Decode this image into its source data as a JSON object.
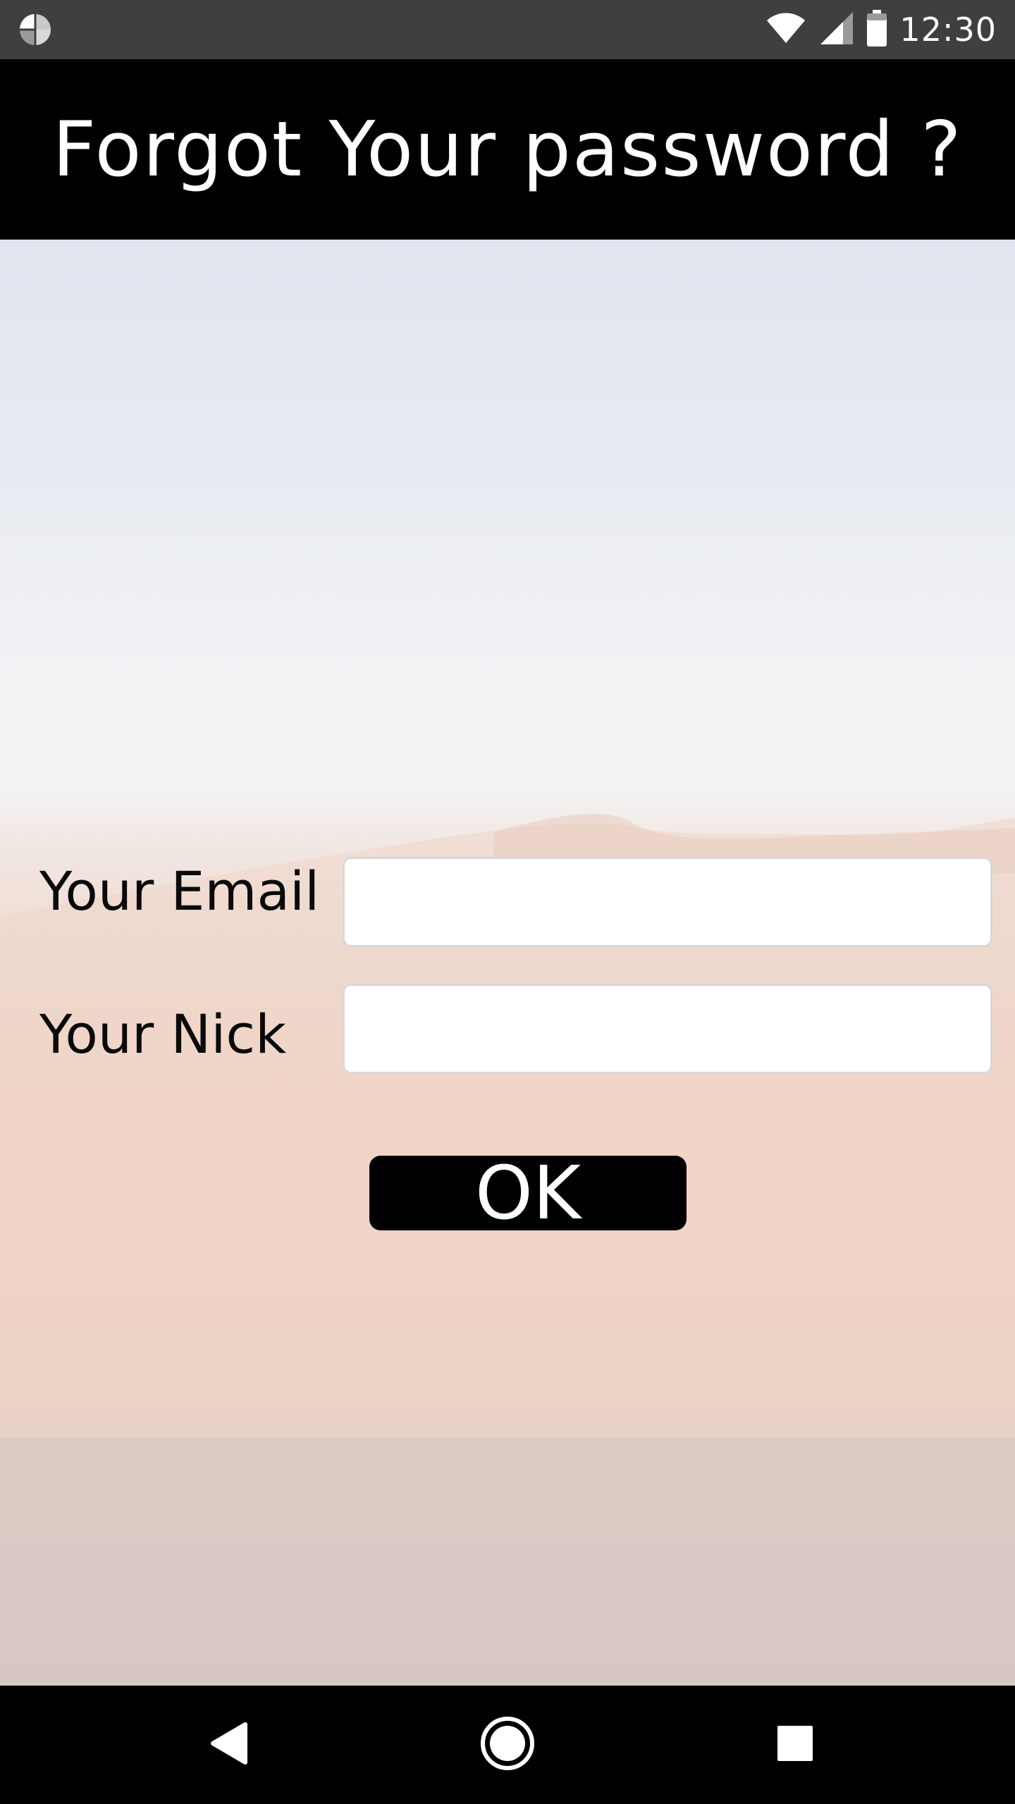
{
  "status_bar": {
    "time": "12:30",
    "app_icon": "pie-chart-icon",
    "icons": [
      "wifi-icon",
      "signal-icon",
      "battery-icon"
    ]
  },
  "header": {
    "title": "Forgot Your password ?"
  },
  "form": {
    "email_label": "Your Email",
    "email_value": "",
    "nick_label": "Your Nick",
    "nick_value": "",
    "ok_label": "OK"
  },
  "nav_bar": {
    "buttons": [
      "back-icon",
      "home-icon",
      "recents-icon"
    ]
  },
  "colors": {
    "header_bg": "#000000",
    "status_bar_bg": "#3f3f3f",
    "button_bg": "#000000",
    "button_text": "#ffffff"
  }
}
